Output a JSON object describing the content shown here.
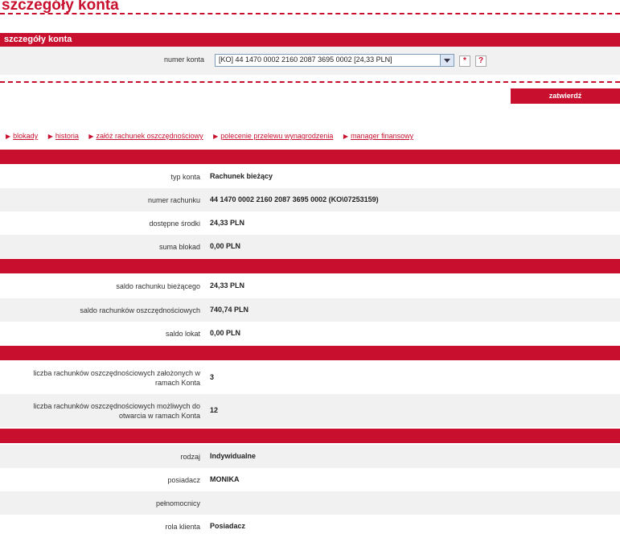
{
  "page": {
    "title": "szczegóły konta"
  },
  "section": {
    "title": "szczegóły konta"
  },
  "account": {
    "label": "numer konta",
    "selected": "[KO] 44 1470 0002 2160 2087 3695 0002 [24,33 PLN]",
    "star_glyph": "*",
    "help_glyph": "?"
  },
  "confirm_label": "zatwierdź",
  "links": [
    "blokady",
    "historia",
    "załóż rachunek oszczędnościowy",
    "polecenie przelewu wynagrodzenia",
    "manager finansowy"
  ],
  "details": {
    "typ": {
      "label": "typ konta",
      "value": "Rachunek bieżący"
    },
    "numer": {
      "label": "numer rachunku",
      "value": "44 1470 0002 2160 2087 3695 0002 (KO\\07253159)"
    },
    "srodki": {
      "label": "dostępne środki",
      "value": "24,33 PLN"
    },
    "blokady": {
      "label": "suma blokad",
      "value": "0,00 PLN"
    }
  },
  "balances": {
    "biezacy": {
      "label": "saldo rachunku bieżącego",
      "value": "24,33 PLN"
    },
    "oszcz": {
      "label": "saldo rachunków oszczędnościowych",
      "value": "740,74 PLN"
    },
    "lokat": {
      "label": "saldo lokat",
      "value": "0,00 PLN"
    }
  },
  "counts": {
    "zalozone": {
      "label_1": "liczba rachunków oszczędnościowych założonych w",
      "label_2": "ramach Konta",
      "value": "3"
    },
    "mozliwe": {
      "label_1": "liczba rachunków oszczędnościowych możliwych do",
      "label_2": "otwarcia w ramach Konta",
      "value": "12"
    }
  },
  "owners": {
    "rodzaj": {
      "label": "rodzaj",
      "value": "Indywidualne"
    },
    "posiadacz": {
      "label": "posiadacz",
      "value": "MONIKA"
    },
    "pelnomocnicy": {
      "label": "pełnomocnicy",
      "value": ""
    },
    "rola": {
      "label": "rola klienta",
      "value": "Posiadacz"
    }
  }
}
